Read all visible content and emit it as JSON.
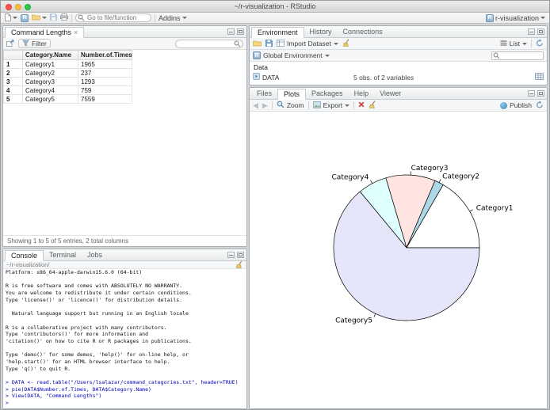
{
  "window": {
    "title": "~/r-visualization - RStudio",
    "project_label": "r-visualization"
  },
  "main_toolbar": {
    "goto_placeholder": "Go to file/function",
    "addins_label": "Addins"
  },
  "data_viewer": {
    "tab_label": "Command Lengths",
    "filter_label": "Filter",
    "columns": [
      "",
      "Category.Name",
      "Number.of.Times"
    ],
    "rows": [
      [
        "1",
        "Category1",
        "1965"
      ],
      [
        "2",
        "Category2",
        "237"
      ],
      [
        "3",
        "Category3",
        "1293"
      ],
      [
        "4",
        "Category4",
        "759"
      ],
      [
        "5",
        "Category5",
        "7559"
      ]
    ],
    "footer": "Showing 1 to 5 of 5 entries, 2 total columns"
  },
  "console": {
    "tabs": [
      "Console",
      "Terminal",
      "Jobs"
    ],
    "working_dir": "~/r-visualization/",
    "prompt": ">",
    "lines": [
      {
        "t": "output",
        "text": "Platform: x86_64-apple-darwin15.6.0 (64-bit)"
      },
      {
        "t": "output",
        "text": ""
      },
      {
        "t": "output",
        "text": "R is free software and comes with ABSOLUTELY NO WARRANTY."
      },
      {
        "t": "output",
        "text": "You are welcome to redistribute it under certain conditions."
      },
      {
        "t": "output",
        "text": "Type 'license()' or 'licence()' for distribution details."
      },
      {
        "t": "output",
        "text": ""
      },
      {
        "t": "output",
        "text": "  Natural language support but running in an English locale"
      },
      {
        "t": "output",
        "text": ""
      },
      {
        "t": "output",
        "text": "R is a collaborative project with many contributors."
      },
      {
        "t": "output",
        "text": "Type 'contributors()' for more information and"
      },
      {
        "t": "output",
        "text": "'citation()' on how to cite R or R packages in publications."
      },
      {
        "t": "output",
        "text": ""
      },
      {
        "t": "output",
        "text": "Type 'demo()' for some demos, 'help()' for on-line help, or"
      },
      {
        "t": "output",
        "text": "'help.start()' for an HTML browser interface to help."
      },
      {
        "t": "output",
        "text": "Type 'q()' to quit R."
      },
      {
        "t": "output",
        "text": ""
      },
      {
        "t": "input",
        "text": "DATA <- read.table(\"/Users/lsalazar/command_categories.txt\", header=TRUE)"
      },
      {
        "t": "input",
        "text": "pie(DATA$Number.of.Times, DATA$Category.Name)"
      },
      {
        "t": "input",
        "text": "View(DATA, \"Command Lengths\")"
      },
      {
        "t": "input",
        "text": ""
      }
    ]
  },
  "environment": {
    "tabs": [
      "Environment",
      "History",
      "Connections"
    ],
    "import_dataset_label": "Import Dataset",
    "list_label": "List",
    "scope_label": "Global Environment",
    "section_label": "Data",
    "objects": [
      {
        "name": "DATA",
        "summary": "5 obs. of 2 variables"
      }
    ]
  },
  "plots_pane": {
    "tabs": [
      "Files",
      "Plots",
      "Packages",
      "Help",
      "Viewer"
    ],
    "zoom_label": "Zoom",
    "export_label": "Export",
    "publish_label": "Publish"
  },
  "chart_data": {
    "type": "pie",
    "categories": [
      "Category1",
      "Category2",
      "Category3",
      "Category4",
      "Category5"
    ],
    "values": [
      1965,
      237,
      1293,
      759,
      7559
    ],
    "colors": [
      "#FFFFFF",
      "#ADD8E6",
      "#FFE4E1",
      "#E0FFFF",
      "#E6E6FA"
    ],
    "start_angle_deg": 0,
    "direction": "counterclockwise",
    "labels_shown": true
  }
}
